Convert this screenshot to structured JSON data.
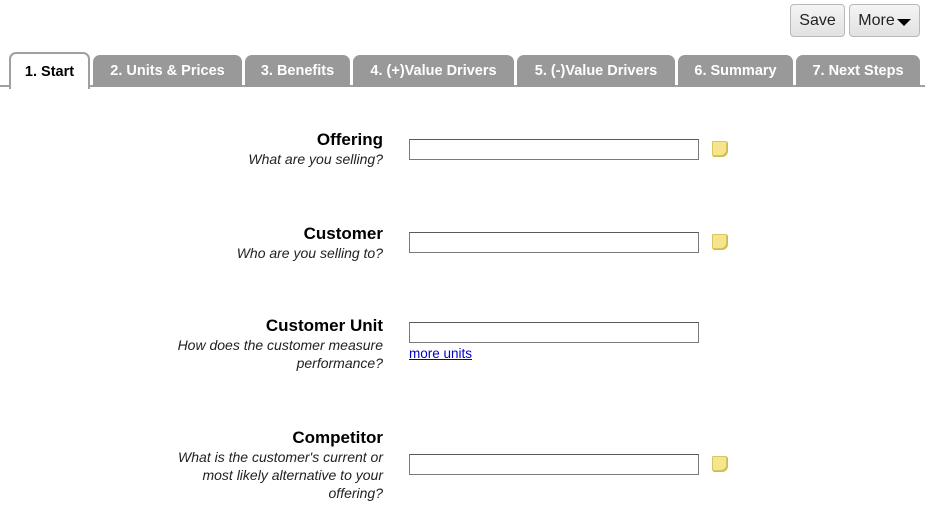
{
  "toolbar": {
    "save_label": "Save",
    "more_label": "More"
  },
  "tabs": [
    {
      "label": "1. Start",
      "active": true
    },
    {
      "label": "2. Units & Prices",
      "active": false
    },
    {
      "label": "3. Benefits",
      "active": false
    },
    {
      "label": "4. (+)Value Drivers",
      "active": false
    },
    {
      "label": "5. (-)Value Drivers",
      "active": false
    },
    {
      "label": "6. Summary",
      "active": false
    },
    {
      "label": "7. Next Steps",
      "active": false
    }
  ],
  "fields": {
    "offering": {
      "title": "Offering",
      "hint": "What are you selling?",
      "value": ""
    },
    "customer": {
      "title": "Customer",
      "hint": "Who are you selling to?",
      "value": ""
    },
    "customer_unit": {
      "title": "Customer Unit",
      "hint_line1": "How does the customer measure",
      "hint_line2": "performance?",
      "value": "",
      "link": "more units"
    },
    "competitor": {
      "title": "Competitor",
      "hint_line1": "What is the customer's current or",
      "hint_line2": "most likely alternative to your",
      "hint_line3": "offering?",
      "value": ""
    }
  },
  "icons": {
    "note": "sticky-note-icon",
    "more_caret": "caret-down-icon"
  },
  "colors": {
    "tab_inactive": "#999999",
    "note": "#f6e58d",
    "link": "#0000cc"
  }
}
